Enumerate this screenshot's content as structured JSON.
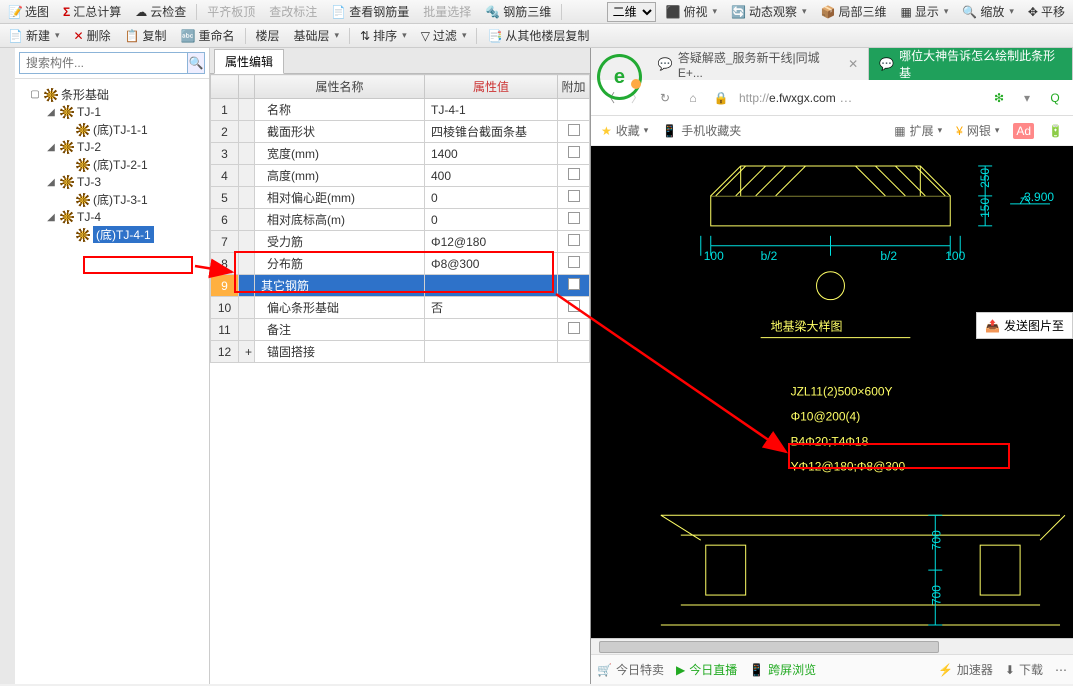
{
  "toolbar1": {
    "items": [
      "选图",
      "汇总计算",
      "云检查",
      "平齐板顶",
      "查改标注",
      "查看钢筋量",
      "批量选择",
      "钢筋三维"
    ],
    "right": [
      "二维",
      "俯视",
      "动态观察",
      "局部三维",
      "显示",
      "缩放",
      "平移"
    ]
  },
  "toolbar2": {
    "new": "新建",
    "del": "删除",
    "copy": "复制",
    "rename": "重命名",
    "floor": "楼层",
    "base": "基础层",
    "sort": "排序",
    "filter": "过滤",
    "copyfrom": "从其他楼层复制"
  },
  "search_placeholder": "搜索构件...",
  "tree": [
    {
      "lvl": 1,
      "label": "条形基础",
      "exp": "▢"
    },
    {
      "lvl": 2,
      "label": "TJ-1",
      "exp": "◢"
    },
    {
      "lvl": 3,
      "label": "(底)TJ-1-1"
    },
    {
      "lvl": 2,
      "label": "TJ-2",
      "exp": "◢"
    },
    {
      "lvl": 3,
      "label": "(底)TJ-2-1"
    },
    {
      "lvl": 2,
      "label": "TJ-3",
      "exp": "◢"
    },
    {
      "lvl": 3,
      "label": "(底)TJ-3-1"
    },
    {
      "lvl": 2,
      "label": "TJ-4",
      "exp": "◢"
    },
    {
      "lvl": 3,
      "label": "(底)TJ-4-1",
      "sel": true
    }
  ],
  "tab_label": "属性编辑",
  "cols": {
    "name": "属性名称",
    "val": "属性值",
    "aux": "附加"
  },
  "rows": [
    {
      "n": "1",
      "name": "名称",
      "val": "TJ-4-1",
      "link": true
    },
    {
      "n": "2",
      "name": "截面形状",
      "val": "四棱锥台截面条基"
    },
    {
      "n": "3",
      "name": "宽度(mm)",
      "val": "1400"
    },
    {
      "n": "4",
      "name": "高度(mm)",
      "val": "400"
    },
    {
      "n": "5",
      "name": "相对偏心距(mm)",
      "val": "0",
      "link": true
    },
    {
      "n": "6",
      "name": "相对底标高(m)",
      "val": "0",
      "link": true
    },
    {
      "n": "7",
      "name": "受力筋",
      "val": "Φ12@180",
      "link": true
    },
    {
      "n": "8",
      "name": "分布筋",
      "val": "Φ8@300",
      "link": true
    },
    {
      "n": "9",
      "name": "其它钢筋",
      "val": "",
      "sel": true
    },
    {
      "n": "10",
      "name": "偏心条形基础",
      "val": "否"
    },
    {
      "n": "11",
      "name": "备注",
      "val": ""
    },
    {
      "n": "12",
      "name": "锚固搭接",
      "val": "",
      "exp": "+"
    }
  ],
  "browser": {
    "tab1": "答疑解惑_服务新干线|同城E+...",
    "tab2": "哪位大神告诉怎么绘制此条形基",
    "url_pre": "http://",
    "url_dom": "e.fwxgx.com",
    "fav": "收藏",
    "mfav": "手机收藏夹",
    "ext": "扩展",
    "bank": "网银",
    "send": "发送图片至",
    "bottom": [
      "今日特卖",
      "今日直播",
      "跨屏浏览",
      "加速器",
      "下载"
    ]
  },
  "cad": {
    "dims": [
      "100",
      "b/2",
      "b/2",
      "100",
      "250",
      "150",
      "-3.900"
    ],
    "title": "地基梁大样图",
    "lines": [
      "JZL11(2)500×600Y",
      "Φ10@200(4)",
      "B4Φ20;T4Φ18",
      "YΦ12@180;Φ8@300"
    ],
    "sidedim": "700"
  }
}
